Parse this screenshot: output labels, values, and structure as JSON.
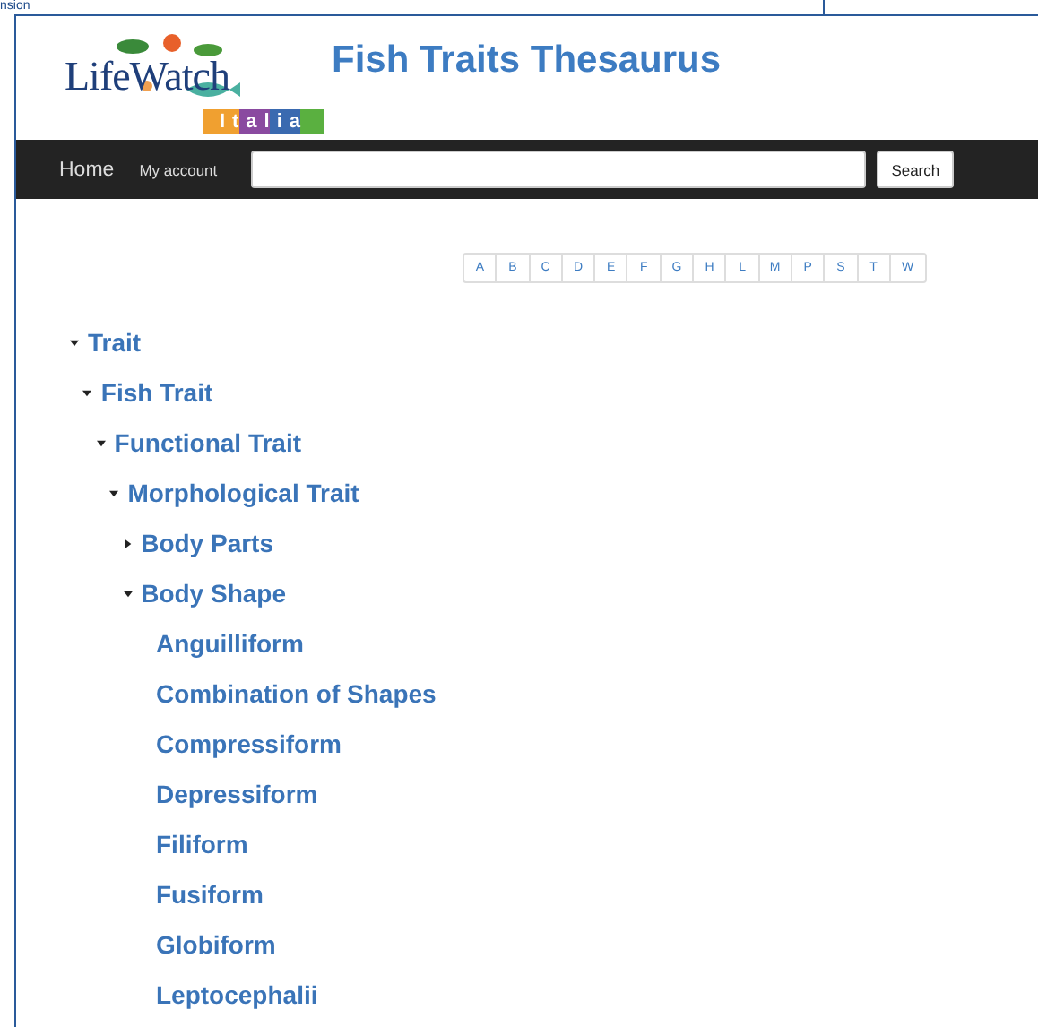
{
  "background_window": {
    "text": "nsion"
  },
  "logo": {
    "name": "LifeWatch",
    "sub": "Italia"
  },
  "site_title": "Fish Traits Thesaurus",
  "navbar": {
    "links": [
      "Home",
      "My account"
    ],
    "search_button": "Search"
  },
  "letters": [
    "A",
    "B",
    "C",
    "D",
    "E",
    "F",
    "G",
    "H",
    "L",
    "M",
    "P",
    "S",
    "T",
    "W"
  ],
  "tree": [
    {
      "label": "Trait",
      "expanded": true,
      "children": [
        {
          "label": "Fish Trait",
          "expanded": true,
          "children": [
            {
              "label": "Functional Trait",
              "expanded": true,
              "children": [
                {
                  "label": "Morphological Trait",
                  "expanded": true,
                  "children": [
                    {
                      "label": "Body Parts",
                      "expanded": false
                    },
                    {
                      "label": "Body Shape",
                      "expanded": true,
                      "children": [
                        {
                          "label": "Anguilliform"
                        },
                        {
                          "label": "Combination of Shapes"
                        },
                        {
                          "label": "Compressiform"
                        },
                        {
                          "label": "Depressiform"
                        },
                        {
                          "label": "Filiform"
                        },
                        {
                          "label": "Fusiform"
                        },
                        {
                          "label": "Globiform"
                        },
                        {
                          "label": "Leptocephalii"
                        }
                      ]
                    }
                  ]
                }
              ]
            }
          ]
        }
      ]
    }
  ]
}
